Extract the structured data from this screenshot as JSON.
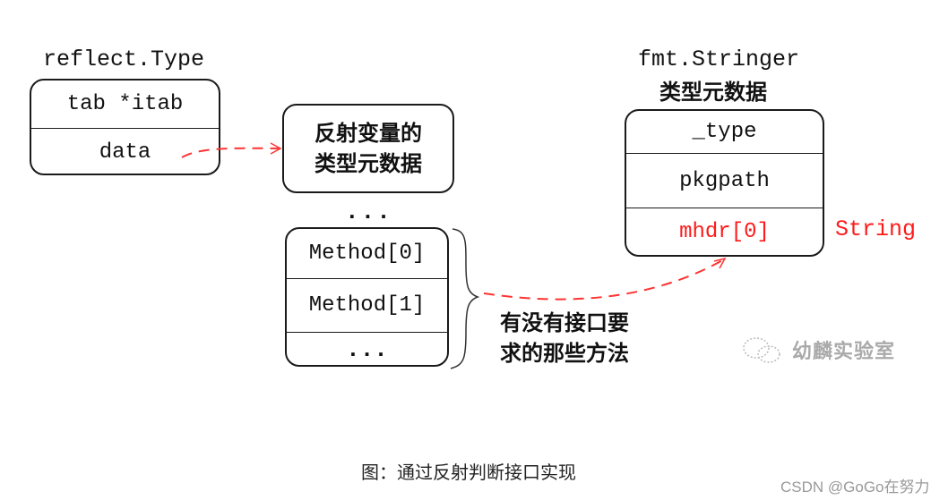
{
  "diagram": {
    "reflect_type": {
      "title": "reflect.Type",
      "fields": [
        "tab *itab",
        "data"
      ]
    },
    "reflected_metadata": {
      "lines": [
        "反射变量的",
        "类型元数据"
      ]
    },
    "ellipsis_between": "...",
    "methods_box": {
      "fields": [
        "Method[0]",
        "Method[1]",
        "..."
      ]
    },
    "methods_note": {
      "lines": [
        "有没有接口要",
        "求的那些方法"
      ]
    },
    "stringer": {
      "title": "fmt.Stringer",
      "subtitle": "类型元数据",
      "fields": [
        "_type",
        "pkgpath",
        "mhdr[0]"
      ],
      "side_label": "String"
    },
    "colors": {
      "arrow": "#ff3333",
      "highlight_text": "#ff1a1a",
      "border": "#1a1a1a"
    }
  },
  "watermark_wechat": "幼麟实验室",
  "caption": "图：通过反射判断接口实现",
  "watermark_csdn": "CSDN @GoGo在努力"
}
